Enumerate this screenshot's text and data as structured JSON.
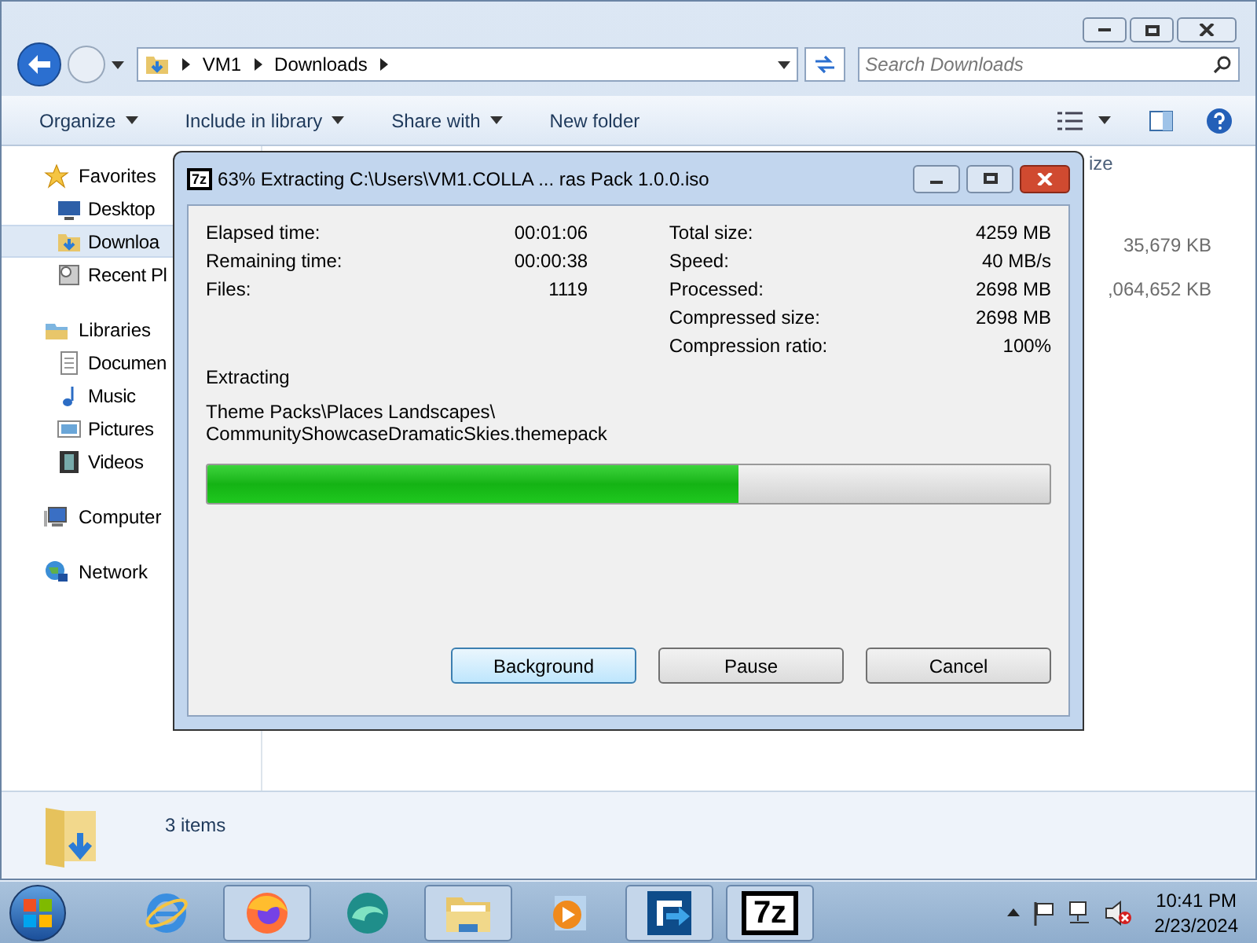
{
  "explorer": {
    "breadcrumb": [
      "VM1",
      "Downloads"
    ],
    "search": {
      "placeholder": "Search Downloads"
    },
    "toolbar": [
      {
        "label": "Organize",
        "dropdown": true
      },
      {
        "label": "Include in library",
        "dropdown": true
      },
      {
        "label": "Share with",
        "dropdown": true
      },
      {
        "label": "New folder",
        "dropdown": false
      }
    ],
    "sidebar": [
      {
        "label": "Favorites",
        "children": [
          {
            "label": "Desktop",
            "selected": false
          },
          {
            "label": "Downloa",
            "selected": true
          },
          {
            "label": "Recent Pl",
            "selected": false
          }
        ]
      },
      {
        "label": "Libraries",
        "children": [
          {
            "label": "Documen",
            "selected": false
          },
          {
            "label": "Music",
            "selected": false
          },
          {
            "label": "Pictures",
            "selected": false
          },
          {
            "label": "Videos",
            "selected": false
          }
        ]
      },
      {
        "label": "Computer"
      },
      {
        "label": "Network"
      }
    ],
    "column_header": "ize",
    "sizes": [
      "35,679 KB",
      ",064,652 KB"
    ],
    "status": "3 items"
  },
  "dialog": {
    "logo": "7z",
    "title": "63% Extracting C:\\Users\\VM1.COLLA ... ras Pack 1.0.0.iso",
    "left_stats": [
      {
        "label": "Elapsed time:",
        "value": "00:01:06"
      },
      {
        "label": "Remaining time:",
        "value": "00:00:38"
      },
      {
        "label": "Files:",
        "value": "1119"
      }
    ],
    "right_stats": [
      {
        "label": "Total size:",
        "value": "4259 MB"
      },
      {
        "label": "Speed:",
        "value": "40 MB/s"
      },
      {
        "label": "Processed:",
        "value": "2698 MB"
      },
      {
        "label": "Compressed size:",
        "value": "2698 MB"
      },
      {
        "label": "Compression ratio:",
        "value": "100%"
      }
    ],
    "operation": "Extracting",
    "path": [
      "Theme Packs\\Places Landscapes\\",
      "CommunityShowcaseDramaticSkies.themepack"
    ],
    "progress": {
      "level": 0.63
    },
    "buttons": [
      {
        "label": "Background",
        "selected": true
      },
      {
        "label": "Pause",
        "selected": false
      },
      {
        "label": "Cancel",
        "selected": false
      }
    ]
  },
  "taskbar": {
    "apps": [
      {
        "kind": "ie",
        "open": false
      },
      {
        "kind": "firefox",
        "open": true
      },
      {
        "kind": "edge",
        "open": false
      },
      {
        "kind": "explorer",
        "open": true
      },
      {
        "kind": "media",
        "open": false
      },
      {
        "kind": "filezilla",
        "open": true
      },
      {
        "kind": "sevenzip",
        "open": true,
        "label": "7z"
      }
    ],
    "time": "10:41 PM",
    "date": "2/23/2024"
  }
}
